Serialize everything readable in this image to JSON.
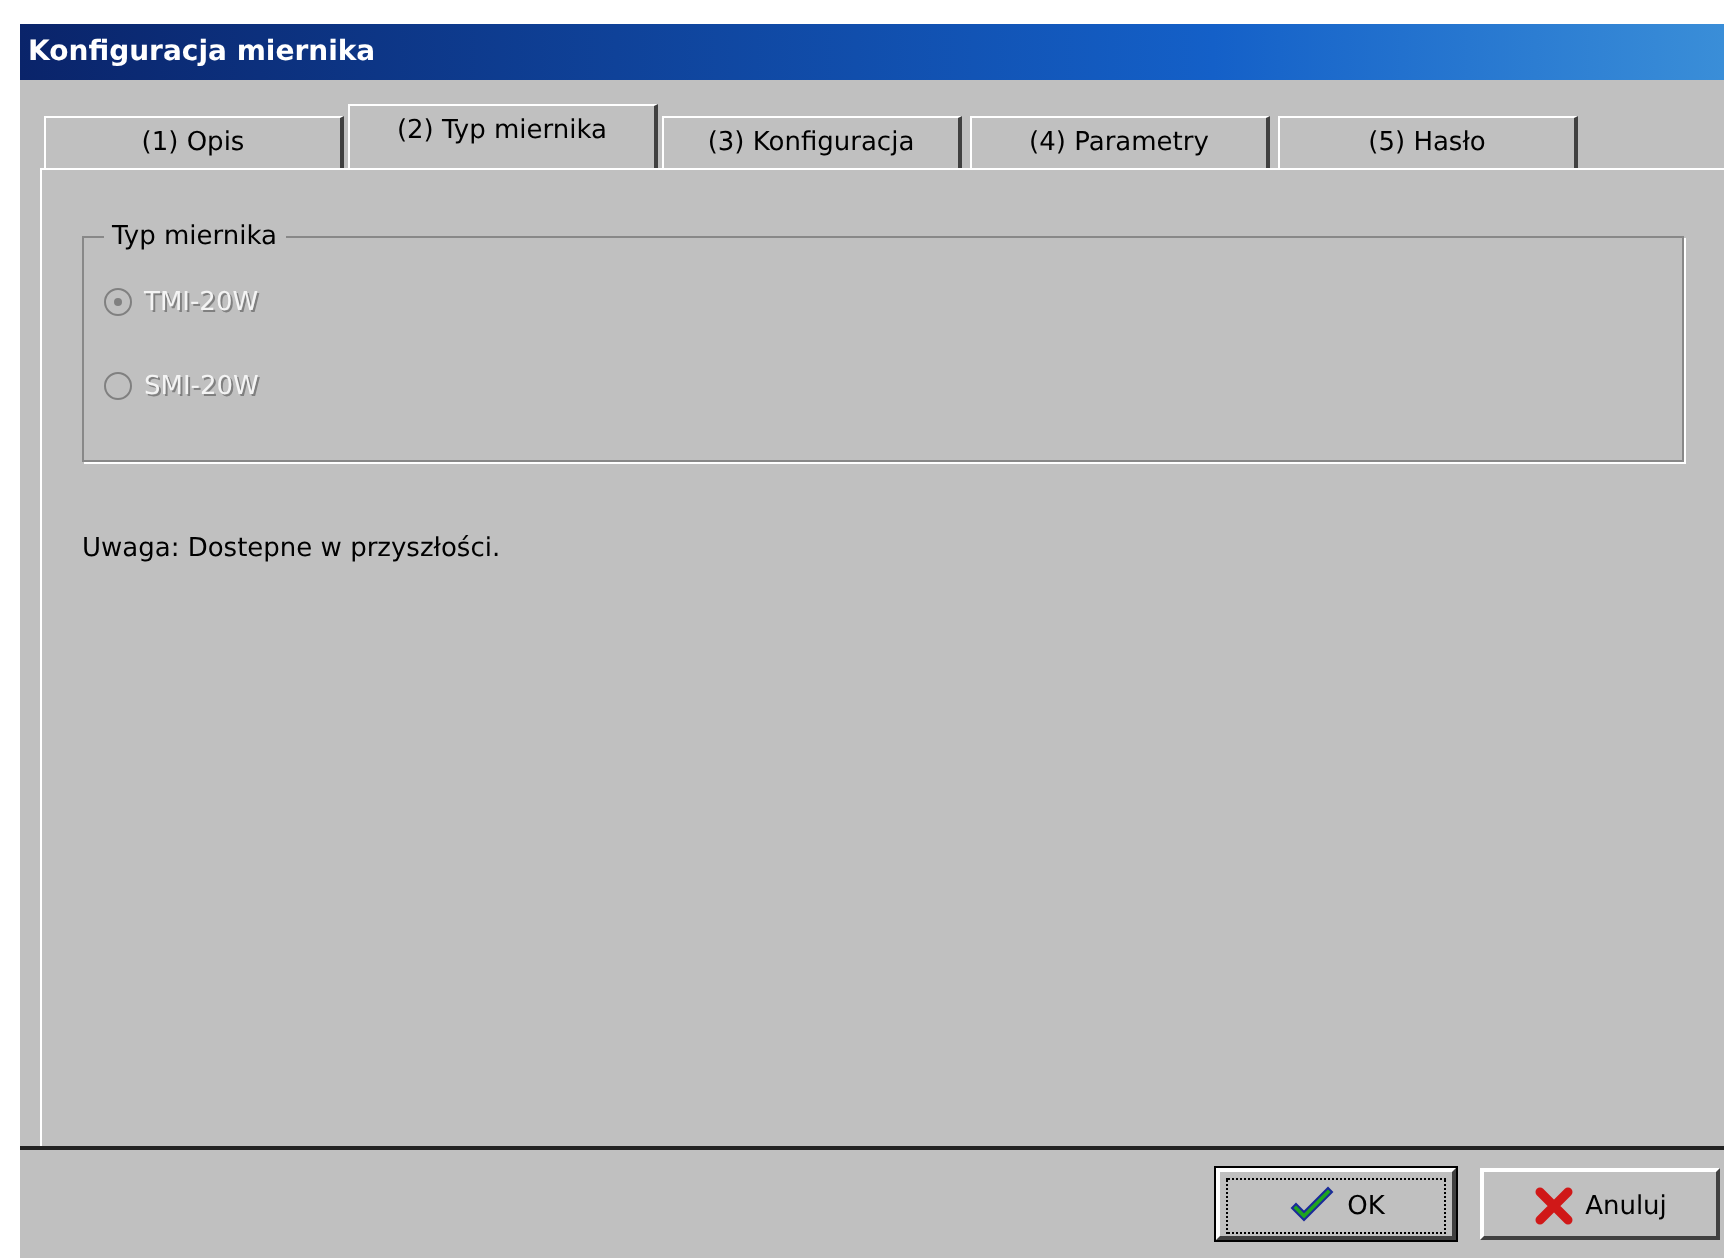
{
  "window": {
    "title": "Konfiguracja miernika"
  },
  "tabs": [
    {
      "label": "(1) Opis",
      "selected": false
    },
    {
      "label": "(2) Typ miernika",
      "selected": true
    },
    {
      "label": "(3) Konfiguracja",
      "selected": false
    },
    {
      "label": "(4) Parametry",
      "selected": false
    },
    {
      "label": "(5) Hasło",
      "selected": false
    }
  ],
  "group": {
    "title": "Typ miernika",
    "options": [
      {
        "label": "TMI-20W",
        "checked": true,
        "disabled": true
      },
      {
        "label": "SMI-20W",
        "checked": false,
        "disabled": true
      }
    ]
  },
  "note": "Uwaga: Dostepne w przyszłości.",
  "buttons": [
    {
      "label": "OK",
      "kind": "ok",
      "focused": true
    },
    {
      "label": "Anuluj",
      "kind": "cancel",
      "focused": false
    }
  ]
}
